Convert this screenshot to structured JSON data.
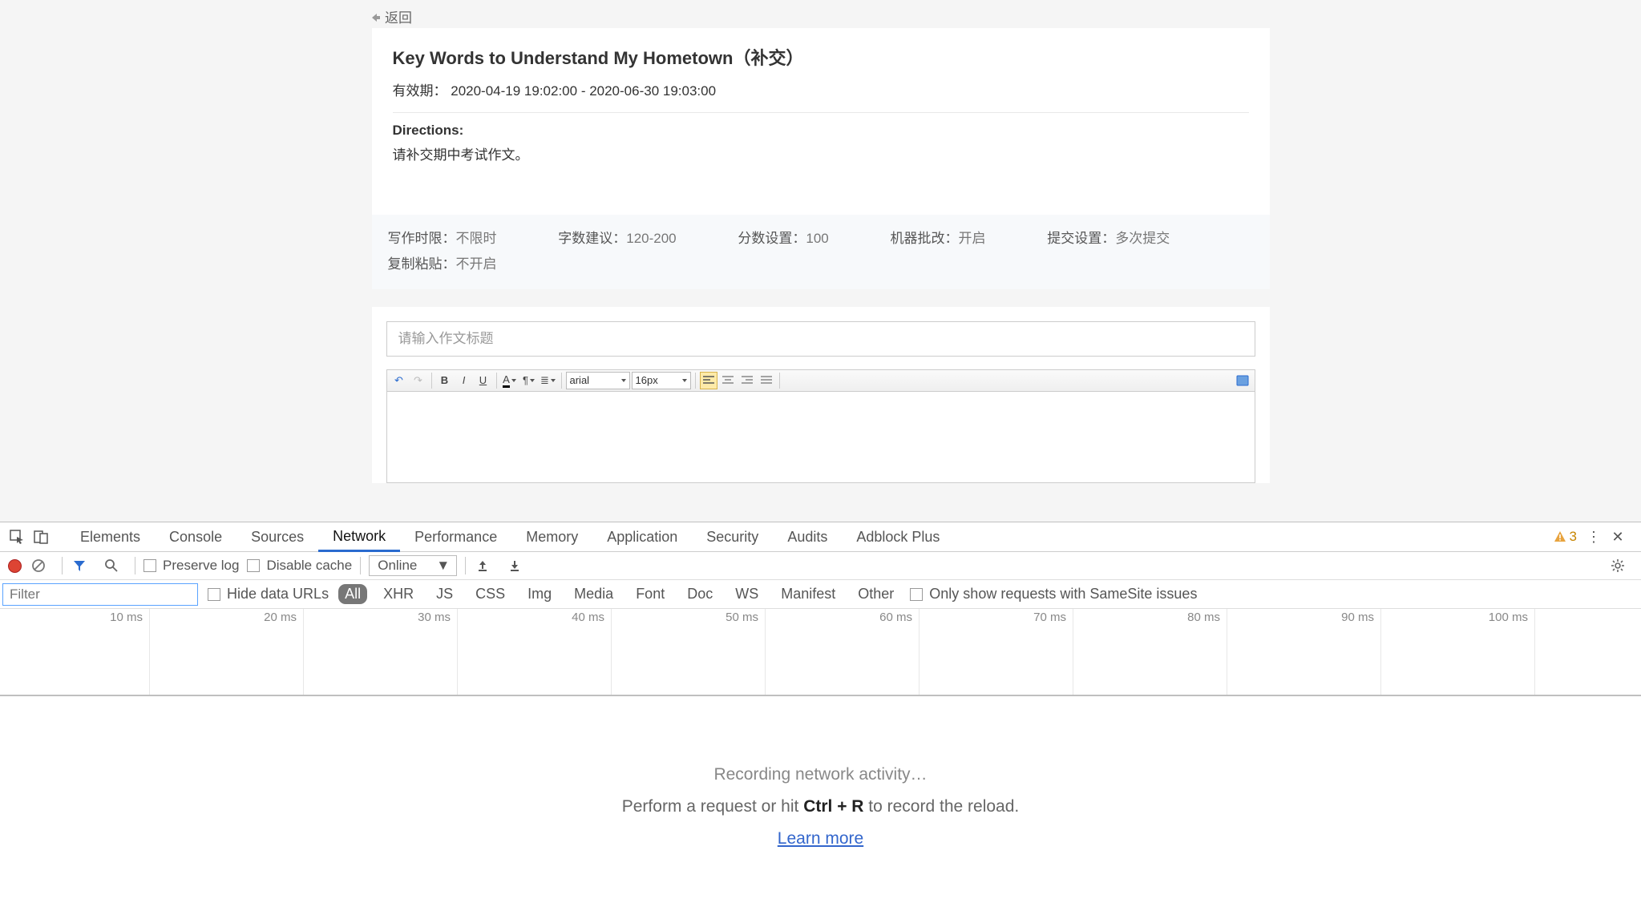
{
  "back": "返回",
  "assignment": {
    "title": "Key Words to Understand My Hometown（补交）",
    "validity_label": "有效期：",
    "validity_value": "2020-04-19 19:02:00 - 2020-06-30 19:03:00",
    "directions_label": "Directions:",
    "directions_text": "请补交期中考试作文。",
    "info": {
      "time_limit_lbl": "写作时限：",
      "time_limit_val": "不限时",
      "word_lbl": "字数建议：",
      "word_val": "120-200",
      "score_lbl": "分数设置：",
      "score_val": "100",
      "machine_lbl": "机器批改：",
      "machine_val": "开启",
      "submit_lbl": "提交设置：",
      "submit_val": "多次提交",
      "paste_lbl": "复制粘贴：",
      "paste_val": "不开启"
    }
  },
  "editor": {
    "title_placeholder": "请输入作文标题",
    "font_family": "arial",
    "font_size": "16px"
  },
  "devtools": {
    "tabs": [
      "Elements",
      "Console",
      "Sources",
      "Network",
      "Performance",
      "Memory",
      "Application",
      "Security",
      "Audits",
      "Adblock Plus"
    ],
    "active_tab": "Network",
    "warnings": "3",
    "preserve_log": "Preserve log",
    "disable_cache": "Disable cache",
    "throttle": "Online",
    "filter_placeholder": "Filter",
    "hide_data_urls": "Hide data URLs",
    "filters": [
      "All",
      "XHR",
      "JS",
      "CSS",
      "Img",
      "Media",
      "Font",
      "Doc",
      "WS",
      "Manifest",
      "Other"
    ],
    "active_filter": "All",
    "samesite": "Only show requests with SameSite issues",
    "ticks": [
      "10 ms",
      "20 ms",
      "30 ms",
      "40 ms",
      "50 ms",
      "60 ms",
      "70 ms",
      "80 ms",
      "90 ms",
      "100 ms"
    ],
    "recording": "Recording network activity…",
    "perform_a": "Perform a request or hit ",
    "ctrl_r": "Ctrl + R",
    "perform_b": " to record the reload.",
    "learn_more": "Learn more"
  }
}
